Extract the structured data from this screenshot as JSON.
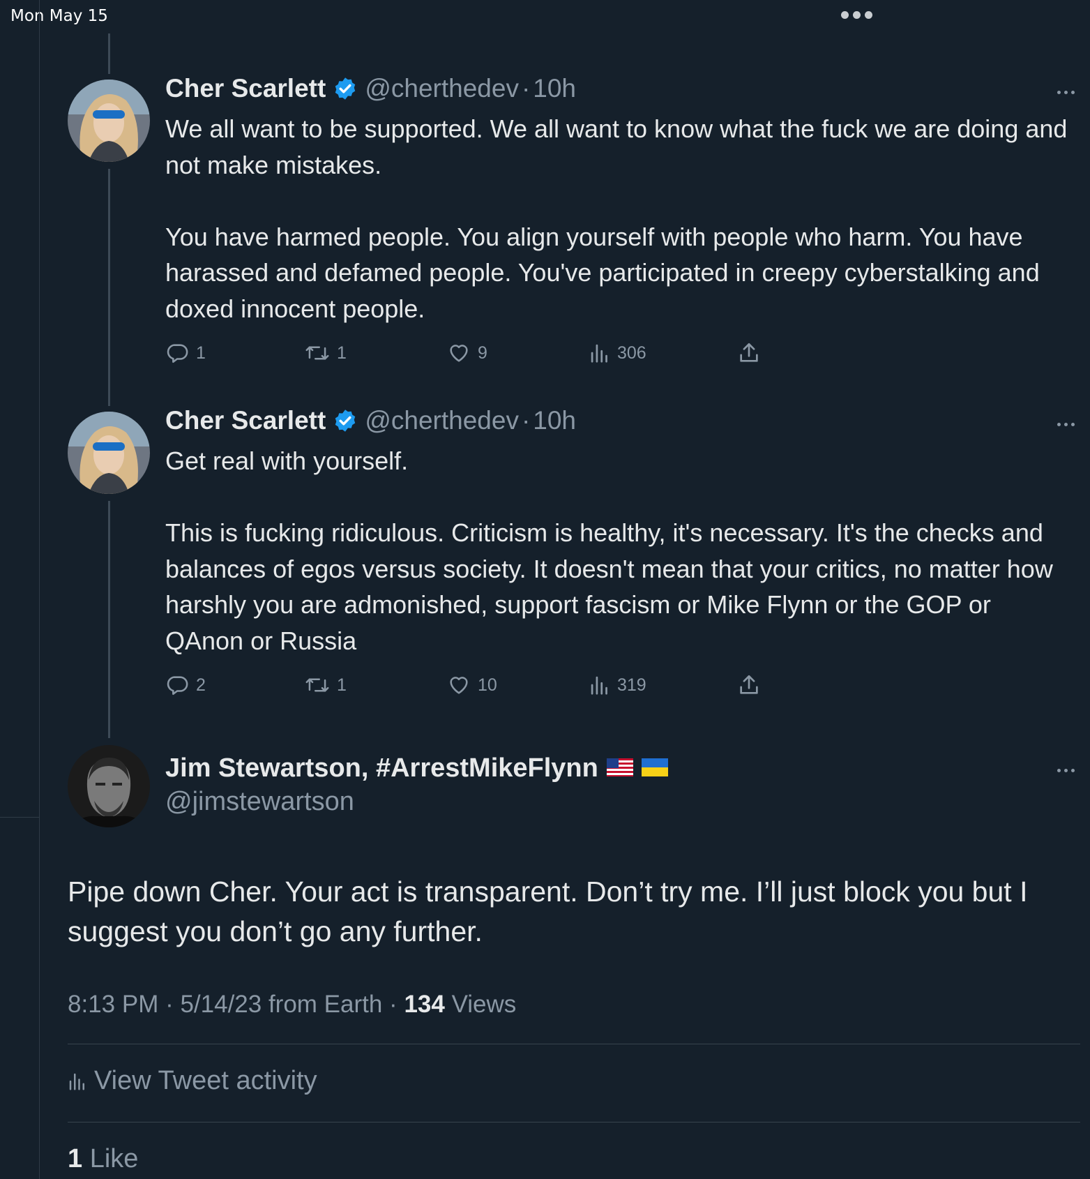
{
  "status_bar": {
    "date": "Mon May 15"
  },
  "colors": {
    "background": "#15202b",
    "verified": "#1d9bf0",
    "muted": "#8b98a5",
    "text": "#e7e9ea"
  },
  "tweets": [
    {
      "name": "Cher Scarlett",
      "handle": "@cherthedev",
      "separator": "·",
      "time": "10h",
      "paragraphs": [
        "We all want to be supported. We all want to know what the fuck we are doing and not make mistakes.",
        "You have harmed people. You align yourself with people who harm. You have harassed and defamed people. You've participated in creepy cyberstalking and doxed innocent people."
      ],
      "replies": "1",
      "retweets": "1",
      "likes": "9",
      "views": "306"
    },
    {
      "name": "Cher Scarlett",
      "handle": "@cherthedev",
      "separator": "·",
      "time": "10h",
      "paragraphs": [
        "Get real with yourself.",
        "This is fucking ridiculous. Criticism is healthy, it's necessary. It's the checks and balances of egos versus society. It doesn't mean that your critics, no matter how harshly you are admonished, support fascism or Mike Flynn or the GOP or QAnon or Russia"
      ],
      "replies": "2",
      "retweets": "1",
      "likes": "10",
      "views": "319"
    }
  ],
  "main_tweet": {
    "name": "Jim Stewartson, #ArrestMikeFlynn",
    "flags": [
      "us-flag-icon",
      "ukraine-flag-icon"
    ],
    "handle": "@jimstewartson",
    "text": "Pipe down Cher. Your act is transparent. Don’t try me. I’ll just block you but I suggest you don’t go any further.",
    "timestamp": "8:13 PM · 5/14/23 from Earth · ",
    "views_count": "134",
    "views_label": " Views",
    "activity_label": "View Tweet activity",
    "likes_count": "1",
    "likes_label": " Like"
  }
}
